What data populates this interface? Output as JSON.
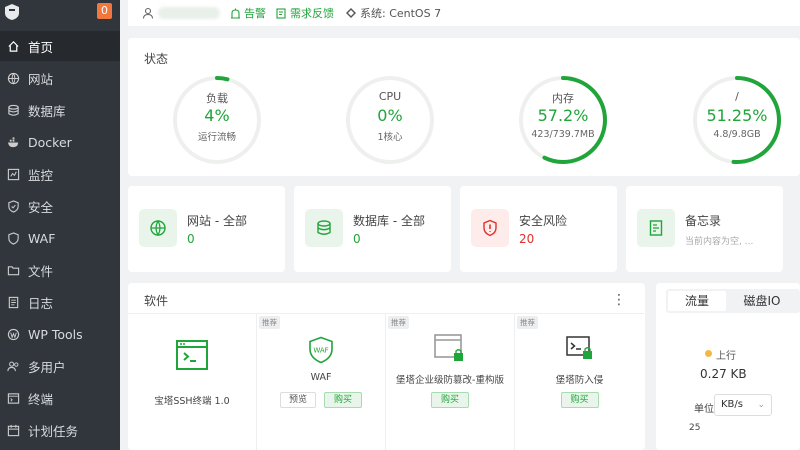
{
  "sidebar": {
    "badge": "0",
    "items": [
      {
        "label": "首页",
        "icon": "home-icon"
      },
      {
        "label": "网站",
        "icon": "globe-icon"
      },
      {
        "label": "数据库",
        "icon": "database-icon"
      },
      {
        "label": "Docker",
        "icon": "docker-icon"
      },
      {
        "label": "监控",
        "icon": "monitor-icon"
      },
      {
        "label": "安全",
        "icon": "shield-icon"
      },
      {
        "label": "WAF",
        "icon": "waf-icon"
      },
      {
        "label": "文件",
        "icon": "folder-icon"
      },
      {
        "label": "日志",
        "icon": "log-icon"
      },
      {
        "label": "WP Tools",
        "icon": "wordpress-icon"
      },
      {
        "label": "多用户",
        "icon": "users-icon"
      },
      {
        "label": "终端",
        "icon": "terminal-icon"
      },
      {
        "label": "计划任务",
        "icon": "calendar-icon"
      }
    ]
  },
  "topbar": {
    "alert": "告警",
    "feedback": "需求反馈",
    "system": "系统:  CentOS 7"
  },
  "status": {
    "title": "状态",
    "gauges": [
      {
        "label": "负载",
        "value": "4%",
        "sub": "运行流畅",
        "percent": 4
      },
      {
        "label": "CPU",
        "value": "0%",
        "sub": "1核心",
        "percent": 0
      },
      {
        "label": "内存",
        "value": "57.2%",
        "sub": "423/739.7MB",
        "percent": 57.2
      },
      {
        "label": "/",
        "value": "51.25%",
        "sub": "4.8/9.8GB",
        "percent": 51.25
      }
    ]
  },
  "overview": {
    "site": {
      "title": "网站 - 全部",
      "value": "0"
    },
    "db": {
      "title": "数据库 - 全部",
      "value": "0"
    },
    "risk": {
      "title": "安全风险",
      "value": "20"
    },
    "memo": {
      "title": "备忘录",
      "note": "当前内容为空, ..."
    }
  },
  "software": {
    "title": "软件",
    "menu": "⋮",
    "recommend_tag": "推荐",
    "preview_label": "预览",
    "buy_label": "购买",
    "items": [
      {
        "name": "宝塔SSH终端 1.0"
      },
      {
        "name": "WAF"
      },
      {
        "name": "堡塔企业级防篡改-重构版"
      },
      {
        "name": "堡塔防入侵"
      }
    ]
  },
  "traffic": {
    "tab_flow": "流量",
    "tab_disk": "磁盘IO",
    "up_label": "上行",
    "up_value": "0.27 KB",
    "unit_label": "单位",
    "unit_value": "KB/s",
    "axis_tick": "25"
  },
  "colors": {
    "accent": "#20a53a",
    "danger": "#e0302c",
    "sidebar": "#31363d"
  }
}
